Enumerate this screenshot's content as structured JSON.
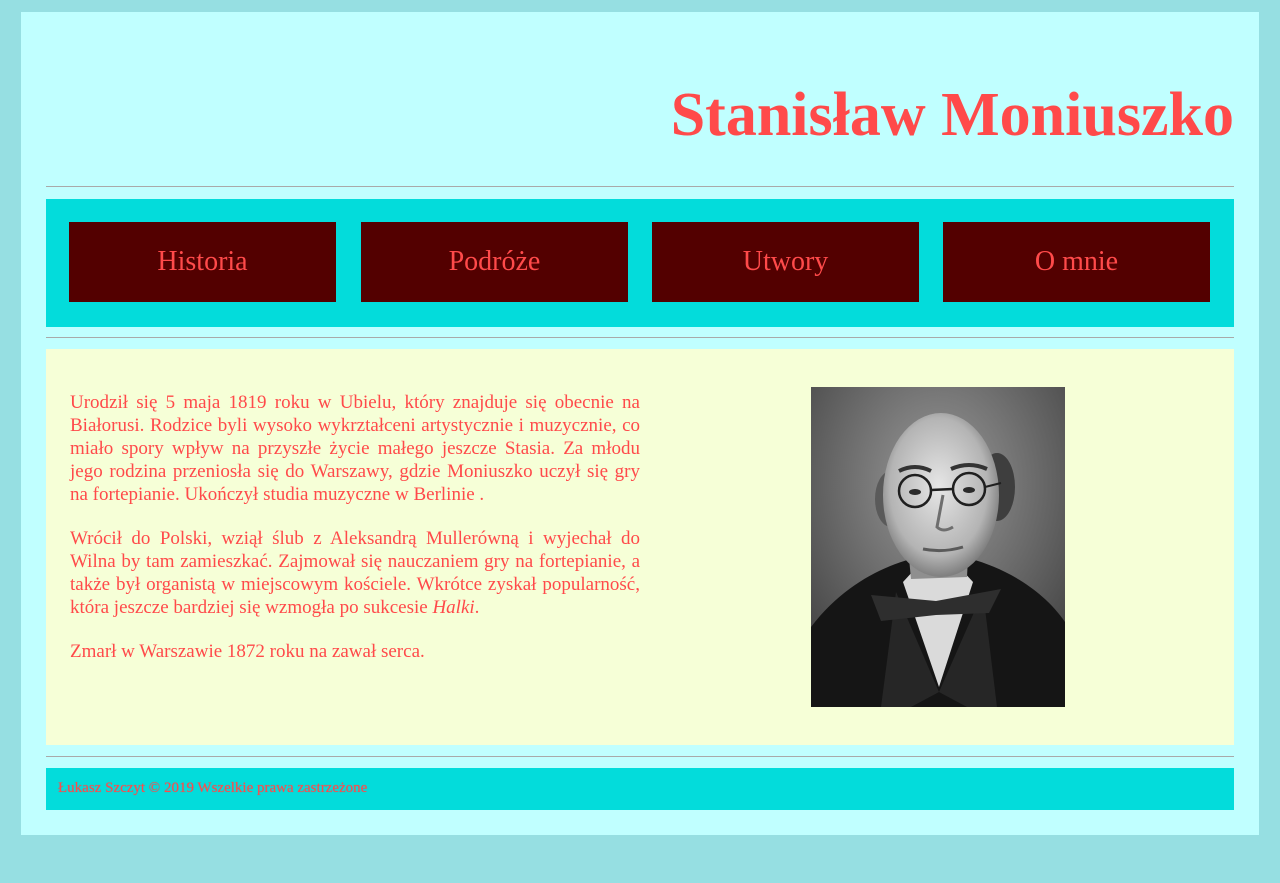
{
  "header": {
    "title": "Stanisław Moniuszko"
  },
  "nav": {
    "items": [
      {
        "label": "Historia"
      },
      {
        "label": "Podróże"
      },
      {
        "label": "Utwory"
      },
      {
        "label": "O mnie"
      }
    ]
  },
  "main": {
    "paragraph_1": "Urodził się 5 maja 1819 roku w Ubielu, który znajduje się obecnie na Białorusi. Rodzice byli wysoko wykrztałceni artystycznie i muzycznie, co miało spory wpływ na przyszłe życie małego jeszcze Stasia. Za młodu jego rodzina przeniosła się do Warszawy, gdzie Moniuszko uczył się gry na fortepianie. Ukończył studia muzyczne w Berlinie .",
    "paragraph_2_main": "Wrócił do Polski, wziął ślub z Aleksandrą Mullerówną i wyjechał do Wilna by tam zamieszkać. Zajmował się nauczaniem gry na fortepianie, a także był organistą w miejscowym kościele. Wkrótce zyskał popularność, która jeszcze bardziej się wzmogła po sukcesie",
    "paragraph_2_work": "Halki",
    "paragraph_2_end": ".",
    "paragraph_3": "Zmarł w Warszawie 1872 roku na zawał serca."
  },
  "footer": {
    "text": "Łukasz Szczyt © 2019 Wszelkie prawa zastrzeżone"
  },
  "colors": {
    "outer_background": "#96dfe2",
    "page_background": "#c0ffff",
    "nav_background": "#03dcdb",
    "nav_button": "#530000",
    "content_background": "#f6ffd7",
    "text": "#ff4a4a"
  }
}
